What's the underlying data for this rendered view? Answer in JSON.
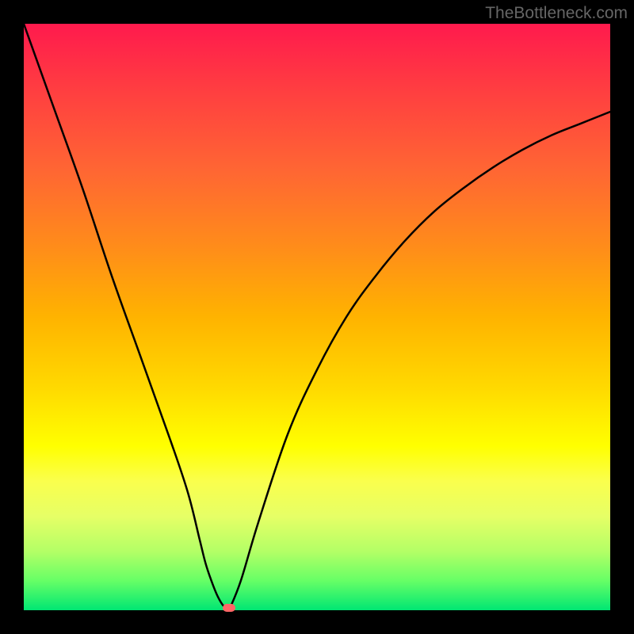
{
  "attribution": "TheBottleneck.com",
  "chart_data": {
    "type": "line",
    "title": "",
    "xlabel": "",
    "ylabel": "",
    "xlim": [
      0,
      100
    ],
    "ylim": [
      0,
      100
    ],
    "grid": false,
    "legend": false,
    "background_gradient": {
      "top": "#ff1a4d",
      "bottom": "#00e673",
      "stops": [
        "#ff1a4d",
        "#ff6633",
        "#ffb300",
        "#ffff00",
        "#b3ff66",
        "#00e673"
      ]
    },
    "series": [
      {
        "name": "left-branch",
        "x": [
          0,
          5,
          10,
          15,
          20,
          25,
          28,
          30,
          31,
          32,
          33,
          34,
          35
        ],
        "y": [
          100,
          86,
          72,
          57,
          43,
          29,
          20,
          12,
          8,
          5,
          2.5,
          0.8,
          0
        ]
      },
      {
        "name": "right-branch",
        "x": [
          35,
          37,
          40,
          45,
          50,
          55,
          60,
          65,
          70,
          75,
          80,
          85,
          90,
          95,
          100
        ],
        "y": [
          0,
          5,
          15,
          30,
          41,
          50,
          57,
          63,
          68,
          72,
          75.5,
          78.5,
          81,
          83,
          85
        ]
      }
    ],
    "minimum_point": {
      "x": 35,
      "y": 0
    },
    "marker": {
      "color": "#ff6666",
      "shape": "rounded-rect"
    }
  }
}
